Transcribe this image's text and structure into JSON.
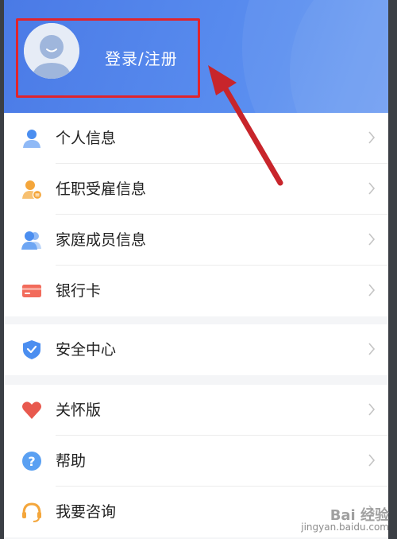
{
  "header": {
    "login_label": "登录/注册"
  },
  "menu_group_1": [
    {
      "label": "个人信息",
      "icon": "person-icon"
    },
    {
      "label": "任职受雇信息",
      "icon": "employee-icon"
    },
    {
      "label": "家庭成员信息",
      "icon": "family-icon"
    },
    {
      "label": "银行卡",
      "icon": "bank-card-icon"
    }
  ],
  "menu_group_2": [
    {
      "label": "安全中心",
      "icon": "shield-icon"
    }
  ],
  "menu_group_3": [
    {
      "label": "关怀版",
      "icon": "heart-icon"
    },
    {
      "label": "帮助",
      "icon": "help-icon"
    },
    {
      "label": "我要咨询",
      "icon": "headset-icon"
    }
  ],
  "watermark": {
    "main": "Bai 经验",
    "sub": "jingyan.baidu.com"
  },
  "colors": {
    "header_blue": "#4a7ae6",
    "highlight_red": "#e0242c",
    "arrow_red": "#c8252b",
    "icon_blue": "#4b8ef0",
    "icon_orange": "#f4a63b",
    "icon_card_red": "#f26b5b",
    "icon_heart": "#e8594e"
  }
}
